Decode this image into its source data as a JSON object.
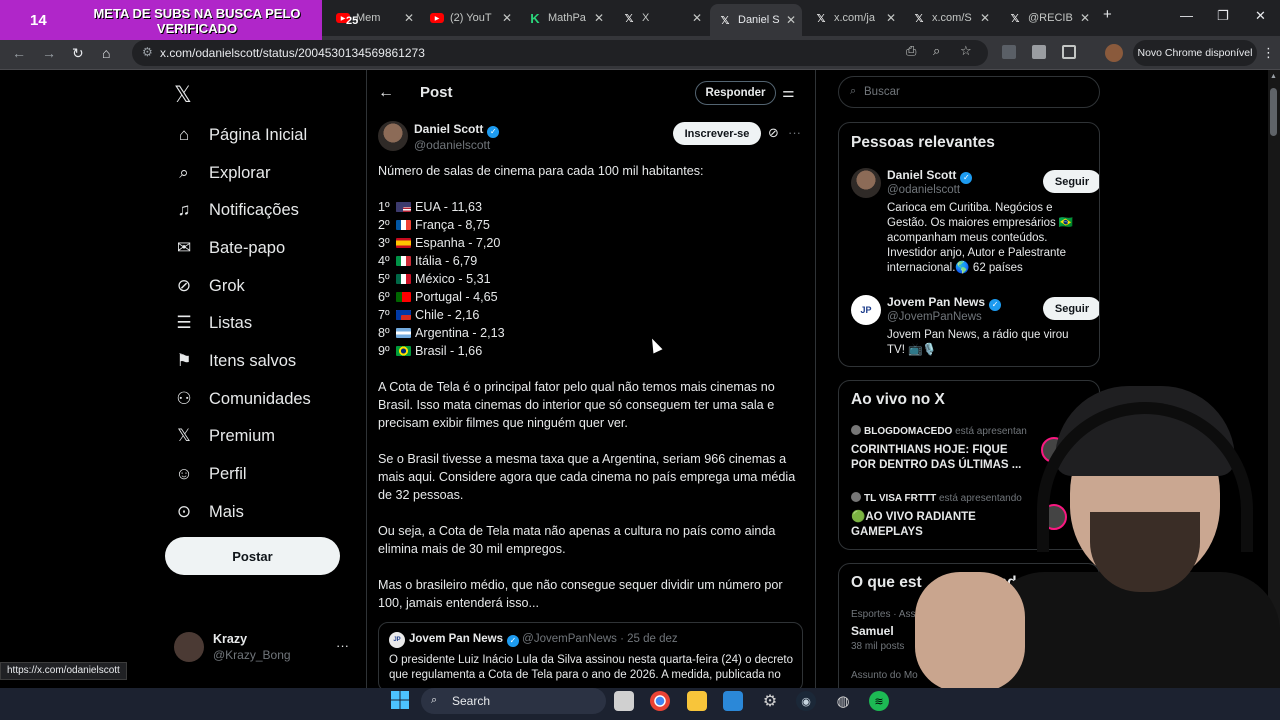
{
  "browser": {
    "stream_banner": {
      "count": "14",
      "overlay_count": "25",
      "text": "META DE SUBS NA BUSCA PELO VERIFICADO"
    },
    "tabs": [
      {
        "title": "Mem",
        "icon": "youtube-icon"
      },
      {
        "title": "(2) YouT",
        "icon": "youtube-icon"
      },
      {
        "title": "MathPa",
        "icon": "mathpapa-icon"
      },
      {
        "title": "X",
        "icon": "x-icon"
      },
      {
        "title": "Daniel S",
        "icon": "x-icon",
        "active": true
      },
      {
        "title": "x.com/ja",
        "icon": "x-icon"
      },
      {
        "title": "x.com/S",
        "icon": "x-icon"
      },
      {
        "title": "@RECIB",
        "icon": "x-icon"
      }
    ],
    "new_tab": "+",
    "url": "x.com/odanielscott/status/2004530134569861273",
    "new_chrome": "Novo Chrome disponível",
    "status_url": "https://x.com/odanielscott"
  },
  "x_nav": {
    "items": [
      {
        "label": "Página Inicial",
        "icon": "home-icon"
      },
      {
        "label": "Explorar",
        "icon": "search-icon"
      },
      {
        "label": "Notificações",
        "icon": "bell-icon"
      },
      {
        "label": "Bate-papo",
        "icon": "mail-icon"
      },
      {
        "label": "Grok",
        "icon": "grok-icon"
      },
      {
        "label": "Listas",
        "icon": "list-icon"
      },
      {
        "label": "Itens salvos",
        "icon": "bookmark-icon"
      },
      {
        "label": "Comunidades",
        "icon": "community-icon"
      },
      {
        "label": "Premium",
        "icon": "x-premium-icon"
      },
      {
        "label": "Perfil",
        "icon": "person-icon"
      },
      {
        "label": "Mais",
        "icon": "more-circle-icon"
      }
    ],
    "post_button": "Postar",
    "account": {
      "name": "Krazy",
      "handle": "@Krazy_Bong",
      "more": "···"
    }
  },
  "post": {
    "header_title": "Post",
    "reply_button": "Responder",
    "author_name": "Daniel Scott",
    "author_handle": "@odanielscott",
    "subscribe_button": "Inscrever-se",
    "intro": "Número de salas de cinema para cada 100 mil habitantes:",
    "ranking": [
      {
        "pos": "1º",
        "country": "EUA - 11,63",
        "flag": "us"
      },
      {
        "pos": "2º",
        "country": "França - 8,75",
        "flag": "fr"
      },
      {
        "pos": "3º",
        "country": "Espanha - 7,20",
        "flag": "es"
      },
      {
        "pos": "4º",
        "country": "Itália - 6,79",
        "flag": "it"
      },
      {
        "pos": "5º",
        "country": "México - 5,31",
        "flag": "mx"
      },
      {
        "pos": "6º",
        "country": "Portugal - 4,65",
        "flag": "pt"
      },
      {
        "pos": "7º",
        "country": "Chile - 2,16",
        "flag": "cl"
      },
      {
        "pos": "8º",
        "country": "Argentina - 2,13",
        "flag": "ar"
      },
      {
        "pos": "9º",
        "country": "Brasil - 1,66",
        "flag": "br"
      }
    ],
    "paragraphs": [
      "A Cota de Tela é o principal fator pelo qual não temos mais cinemas no Brasil. Isso mata cinemas do interior que só conseguem ter uma sala e precisam exibir filmes que ninguém quer ver.",
      "Se o Brasil tivesse a mesma taxa que a Argentina, seriam 966 cinemas a mais aqui. Considere agora que cada cinema no país emprega uma média de 32 pessoas.",
      "Ou seja, a Cota de Tela mata não apenas a cultura no país como ainda elimina mais de 30 mil empregos.",
      "Mas o brasileiro médio, que não consegue sequer dividir um número por 100, jamais entenderá isso..."
    ],
    "quote": {
      "name": "Jovem Pan News",
      "handle": "@JovemPanNews",
      "date": "· 25 de dez",
      "text": "O presidente Luiz Inácio Lula da Silva assinou nesta quarta-feira (24) o decreto que regulamenta a Cota de Tela para o ano de 2026. A medida, publicada no"
    }
  },
  "sidebar": {
    "search_placeholder": "Buscar",
    "relevant": {
      "title": "Pessoas relevantes",
      "people": [
        {
          "name": "Daniel Scott",
          "handle": "@odanielscott",
          "bio": "Carioca em Curitiba. Negócios e Gestão. Os maiores empresários 🇧🇷 acompanham meus conteúdos. Investidor anjo, Autor e Palestrante internacional.🌎 62 países",
          "button": "Seguir"
        },
        {
          "name": "Jovem Pan News",
          "handle": "@JovemPanNews",
          "bio": "Jovem Pan News, a rádio que virou TV! 📺🎙️",
          "button": "Seguir"
        }
      ]
    },
    "live": {
      "title": "Ao vivo no X",
      "items": [
        {
          "host": "BLOGDOMACEDO",
          "status": "está apresentan",
          "title": "CORINTHIANS HOJE: FIQUE POR DENTRO DAS ÚLTIMAS ..."
        },
        {
          "host": "TL VISA FRTTT",
          "status": "está apresentando",
          "title": "🟢AO VIVO RADIANTE GAMEPLAYS"
        }
      ]
    },
    "trending": {
      "title": "O que est",
      "title_end": "endo",
      "items": [
        {
          "meta": "Esportes · Assu",
          "name": "Samuel",
          "count": "38 mil posts"
        },
        {
          "meta": "Assunto do Mo",
          "name": "",
          "count": ""
        }
      ]
    }
  },
  "taskbar": {
    "search_label": "Search"
  },
  "colors": {
    "accent_blue": "#1d9bf0",
    "banner_purple": "#b026c9",
    "background": "#000000",
    "live_ring": "#f91880"
  }
}
